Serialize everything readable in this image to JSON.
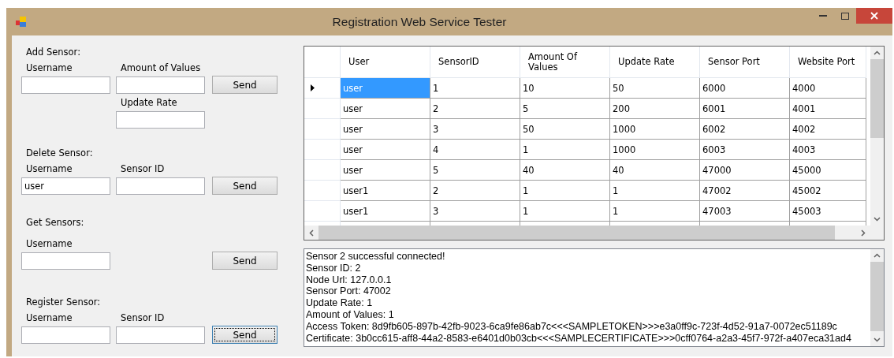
{
  "window": {
    "title": "Registration Web Service Tester"
  },
  "sections": [
    {
      "title": "Add Sensor:",
      "fields": [
        {
          "label": "Username"
        },
        {
          "label": "Amount of Values"
        },
        {
          "label": "Update Rate"
        }
      ],
      "button": {
        "label": "Send",
        "focused": false
      }
    },
    {
      "title": "Delete Sensor:",
      "fields": [
        {
          "label": "Username",
          "value": "user"
        },
        {
          "label": "Sensor ID"
        }
      ],
      "button": {
        "label": "Send",
        "focused": false
      }
    },
    {
      "title": "Get Sensors:",
      "fields": [
        {
          "label": "Username"
        }
      ],
      "button": {
        "label": "Send",
        "focused": false
      }
    },
    {
      "title": "Register Sensor:",
      "fields": [
        {
          "label": "Username"
        },
        {
          "label": "Sensor ID"
        }
      ],
      "button": {
        "label": "Send",
        "focused": true
      }
    }
  ],
  "table": {
    "columns": [
      "User",
      "SensorID",
      "Amount Of Values",
      "Update Rate",
      "Sensor Port",
      "Website Port"
    ],
    "rows": [
      {
        "selected": true,
        "cells": [
          "user",
          "1",
          "10",
          "50",
          "6000",
          "4000"
        ]
      },
      {
        "selected": false,
        "cells": [
          "user",
          "2",
          "5",
          "200",
          "6001",
          "4001"
        ]
      },
      {
        "selected": false,
        "cells": [
          "user",
          "3",
          "50",
          "1000",
          "6002",
          "4002"
        ]
      },
      {
        "selected": false,
        "cells": [
          "user",
          "4",
          "1",
          "1000",
          "6003",
          "4003"
        ]
      },
      {
        "selected": false,
        "cells": [
          "user",
          "5",
          "40",
          "40",
          "47000",
          "45000"
        ]
      },
      {
        "selected": false,
        "cells": [
          "user1",
          "2",
          "1",
          "1",
          "47002",
          "45002"
        ]
      },
      {
        "selected": false,
        "cells": [
          "user1",
          "3",
          "1",
          "1",
          "47003",
          "45003"
        ]
      }
    ]
  },
  "log": [
    "Sensor 2 successful connected!",
    "Sensor ID: 2",
    "Node Url: 127.0.0.1",
    "Sensor Port: 47002",
    "Update Rate: 1",
    "Amount of Values: 1",
    "Access Token: 8d9fb605-897b-42fb-9023-6ca9fe86ab7c<<<SAMPLETOKEN>>>e3a0ff9c-723f-4d52-91a7-0072ec51189c",
    "Certificate: 3b0cc615-aff8-44a2-8583-e6401d0b03cb<<<SAMPLECERTIFICATE>>>0cff0764-a2a3-45f7-972f-a407eca31ad4"
  ]
}
